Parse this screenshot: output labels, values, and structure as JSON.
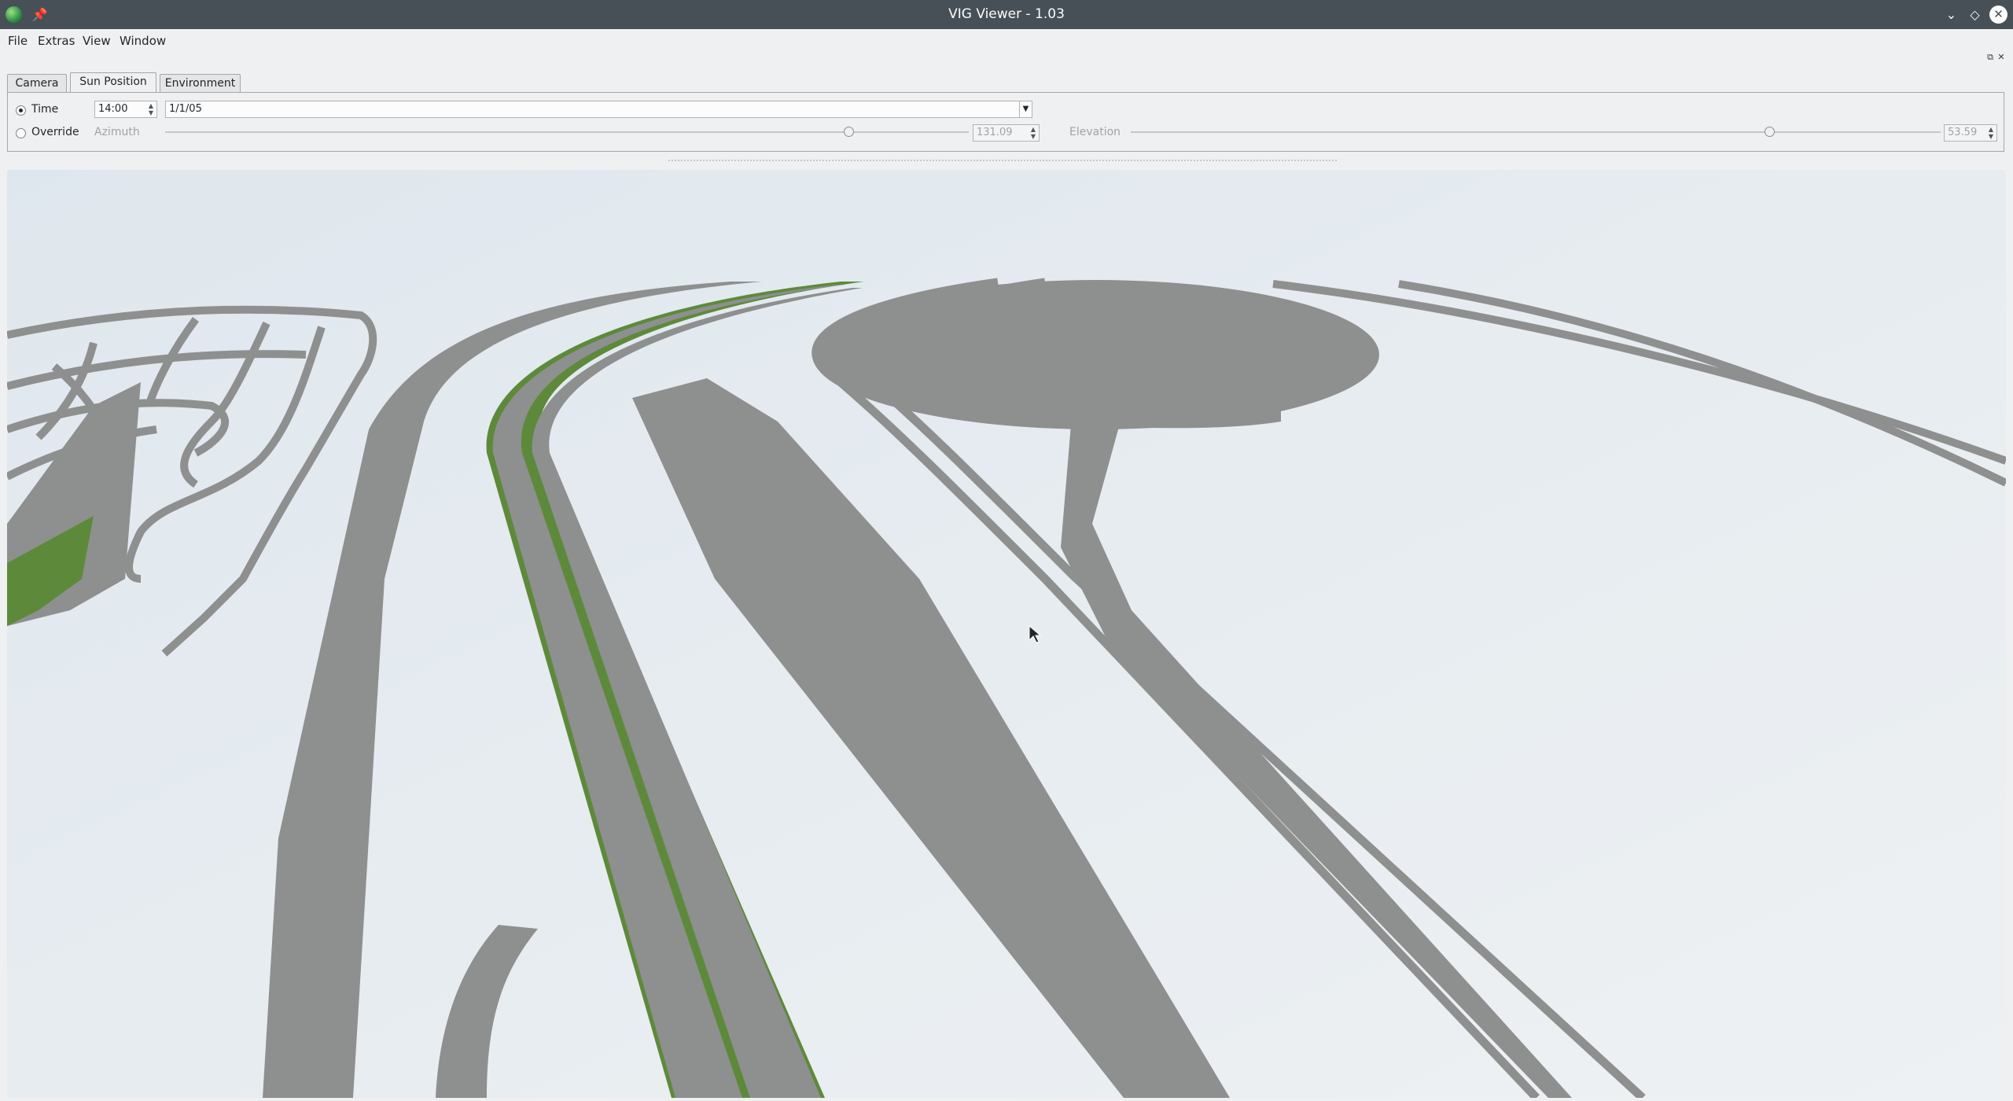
{
  "window": {
    "title": "VIG Viewer - 1.03"
  },
  "menu": {
    "file": "File",
    "extras": "Extras",
    "view": "View",
    "window": "Window"
  },
  "tabs": [
    {
      "label": "Camera"
    },
    {
      "label": "Sun Position",
      "active": true
    },
    {
      "label": "Environment"
    }
  ],
  "sun": {
    "time_label": "Time",
    "time_value": "14:00",
    "date_value": "1/1/05",
    "mode_selected": "Time",
    "override_label": "Override",
    "azimuth_label": "Azimuth",
    "azimuth_value": "131.09",
    "azimuth_fraction": 0.855,
    "elevation_label": "Elevation",
    "elevation_value": "53.59",
    "elevation_fraction": 0.793
  },
  "icons": {
    "app": "globe-icon",
    "pin": "pin-icon",
    "minimize": "chevron-down-icon",
    "maximize": "diamond-icon",
    "close": "close-icon",
    "float": "float-icon",
    "dock_close": "close-icon"
  },
  "colors": {
    "titlebar": "#475057",
    "road": "#8e8f8f",
    "grass": "#5d8a3a",
    "sky": "#e2e9ee"
  }
}
